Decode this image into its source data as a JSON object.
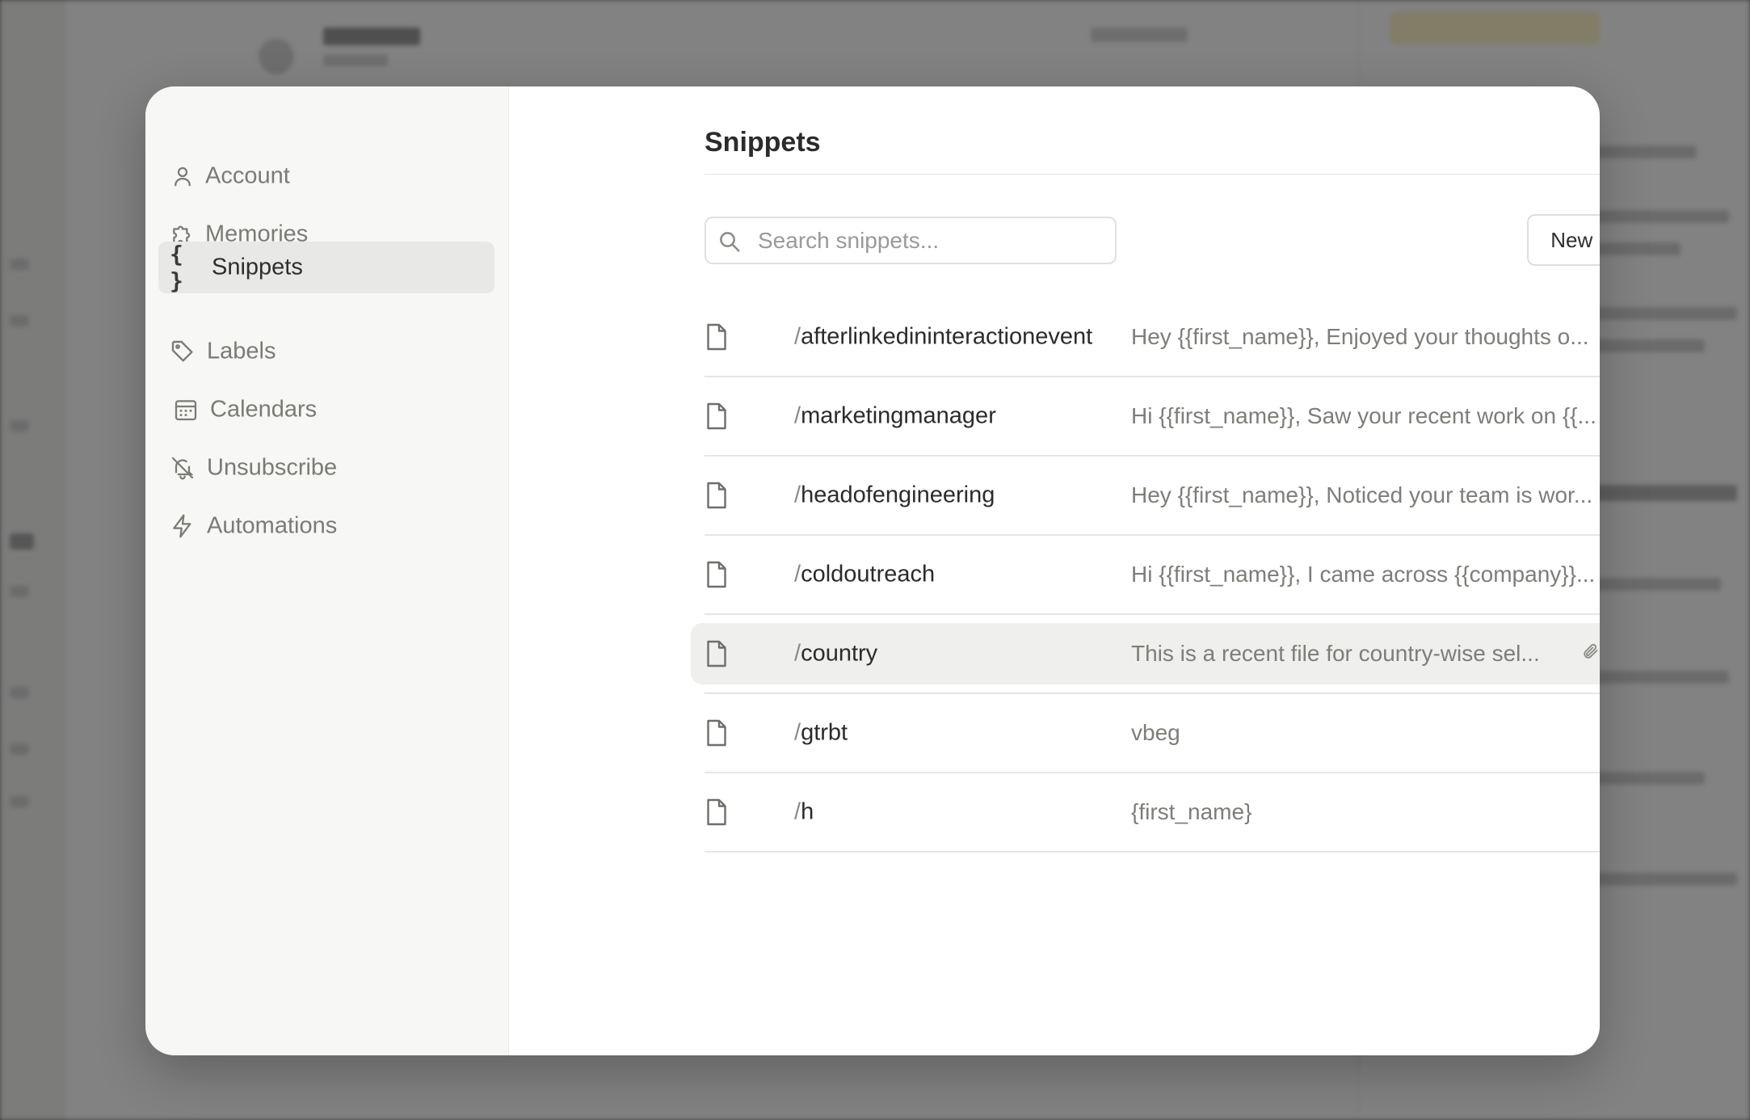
{
  "sidebar": {
    "items": [
      {
        "label": "Account",
        "icon": "user-icon",
        "active": false
      },
      {
        "label": "Memories",
        "icon": "puzzle-icon",
        "active": false
      },
      {
        "label": "Snippets",
        "icon": "braces-icon",
        "icon_glyph": "{ }",
        "active": true
      },
      {
        "label": "Labels",
        "icon": "tag-icon",
        "active": false
      },
      {
        "label": "Calendars",
        "icon": "calendar-icon",
        "active": false
      },
      {
        "label": "Unsubscribe",
        "icon": "bell-off-icon",
        "active": false
      },
      {
        "label": "Automations",
        "icon": "lightning-icon",
        "active": false
      }
    ]
  },
  "main": {
    "title": "Snippets",
    "search": {
      "placeholder": "Search snippets...",
      "value": ""
    },
    "new_button_label": "New Snippet"
  },
  "snippets": [
    {
      "slash": "/",
      "name": "afterlinkedininteractionevent",
      "preview": "Hey {{first_name}}, Enjoyed your thoughts o...",
      "attachments": null
    },
    {
      "slash": "/",
      "name": "marketingmanager",
      "preview": "Hi {{first_name}}, Saw your recent work on {{...",
      "attachments": null
    },
    {
      "slash": "/",
      "name": "headofengineering",
      "preview": "Hey {{first_name}}, Noticed your team is wor...",
      "attachments": null
    },
    {
      "slash": "/",
      "name": "coldoutreach",
      "preview": "Hi {{first_name}}, I came across {{company}}...",
      "attachments": null
    },
    {
      "slash": "/",
      "name": "country",
      "preview": "This is a recent file for country-wise sel...",
      "attachments": "1",
      "highlighted": true
    },
    {
      "slash": "/",
      "name": "gtrbt",
      "preview": "vbeg",
      "attachments": null
    },
    {
      "slash": "/",
      "name": "h",
      "preview": "{first_name}",
      "attachments": null
    }
  ],
  "colors": {
    "sidebar_bg": "#f7f7f5",
    "active_item_bg": "#e8e8e6",
    "hover_row_bg": "#efefed",
    "overlay": "rgba(0,0,0,0.49)"
  }
}
